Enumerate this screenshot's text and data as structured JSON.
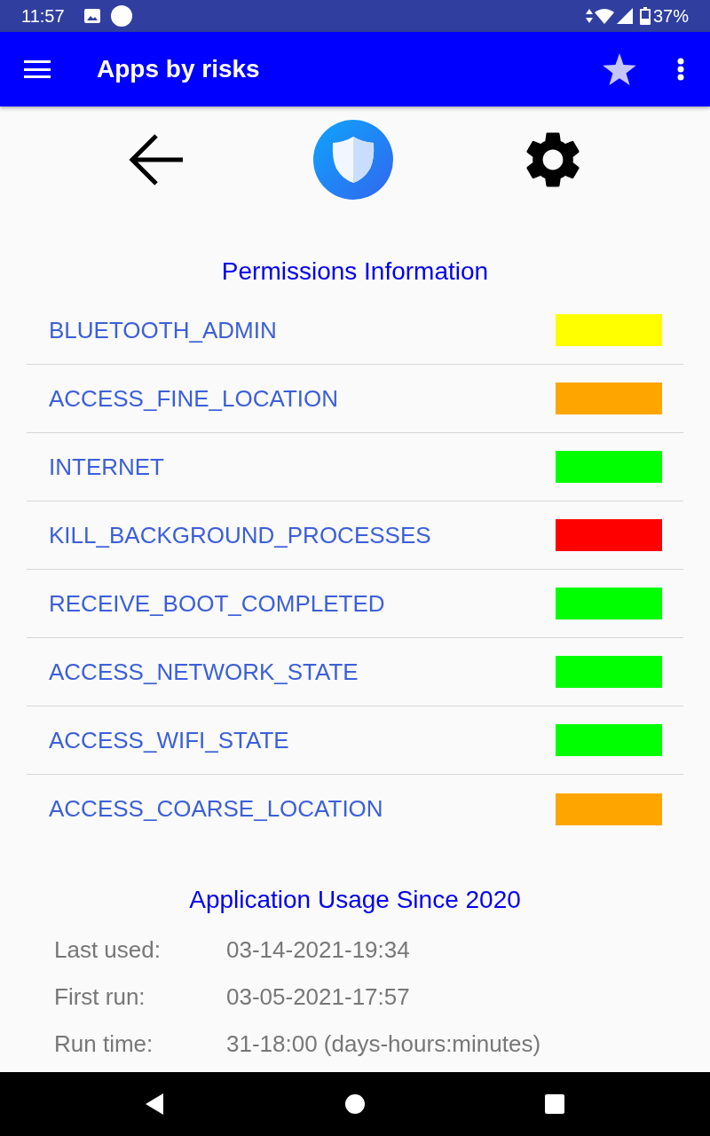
{
  "status_bar": {
    "time": "11:57",
    "battery": "37%"
  },
  "app_bar": {
    "title": "Apps by risks"
  },
  "permissions": {
    "title": "Permissions Information",
    "items": [
      {
        "name": "BLUETOOTH_ADMIN",
        "color": "#ffff00"
      },
      {
        "name": "ACCESS_FINE_LOCATION",
        "color": "#ffa500"
      },
      {
        "name": "INTERNET",
        "color": "#00ff00"
      },
      {
        "name": "KILL_BACKGROUND_PROCESSES",
        "color": "#ff0000"
      },
      {
        "name": "RECEIVE_BOOT_COMPLETED",
        "color": "#00ff00"
      },
      {
        "name": "ACCESS_NETWORK_STATE",
        "color": "#00ff00"
      },
      {
        "name": "ACCESS_WIFI_STATE",
        "color": "#00ff00"
      },
      {
        "name": "ACCESS_COARSE_LOCATION",
        "color": "#ffa500"
      }
    ]
  },
  "usage": {
    "title": "Application Usage Since 2020",
    "rows": [
      {
        "label": "Last used:",
        "value": "03-14-2021-19:34"
      },
      {
        "label": "First run:",
        "value": "03-05-2021-17:57"
      },
      {
        "label": "Run time:",
        "value": "31-18:00 (days-hours:minutes)"
      }
    ]
  }
}
